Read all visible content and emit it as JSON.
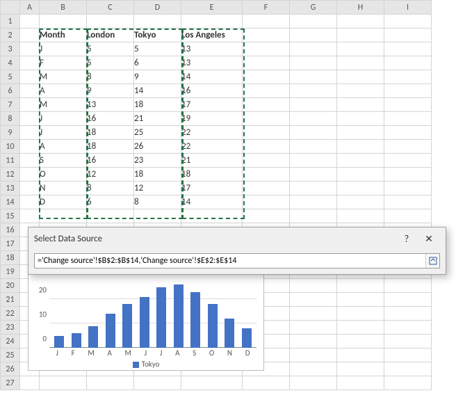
{
  "columns": [
    "A",
    "B",
    "C",
    "D",
    "E",
    "F",
    "G",
    "H",
    "I"
  ],
  "rowCount": 27,
  "table": {
    "headers": {
      "month": "Month",
      "london": "London",
      "tokyo": "Tokyo",
      "la": "Los Angeles"
    },
    "rows": [
      {
        "m": "J",
        "london": "5",
        "tokyo": "5",
        "la": "13"
      },
      {
        "m": "F",
        "london": "5",
        "tokyo": "6",
        "la": "13"
      },
      {
        "m": "M",
        "london": "8",
        "tokyo": "9",
        "la": "14"
      },
      {
        "m": "A",
        "london": "9",
        "tokyo": "14",
        "la": "16"
      },
      {
        "m": "M",
        "london": "13",
        "tokyo": "18",
        "la": "17"
      },
      {
        "m": "J",
        "london": "16",
        "tokyo": "21",
        "la": "19"
      },
      {
        "m": "J",
        "london": "18",
        "tokyo": "25",
        "la": "22"
      },
      {
        "m": "A",
        "london": "18",
        "tokyo": "26",
        "la": "22"
      },
      {
        "m": "S",
        "london": "16",
        "tokyo": "23",
        "la": "21"
      },
      {
        "m": "O",
        "london": "12",
        "tokyo": "18",
        "la": "18"
      },
      {
        "m": "N",
        "london": "8",
        "tokyo": "12",
        "la": "17"
      },
      {
        "m": "D",
        "london": "6",
        "tokyo": "8",
        "la": "14"
      }
    ]
  },
  "dialog": {
    "title": "Select Data Source",
    "help": "?",
    "close": "✕",
    "formula": "='Change source'!$B$2:$B$14,'Change source'!$E$2:$E$14"
  },
  "chart_data": {
    "type": "bar",
    "categories": [
      "J",
      "F",
      "M",
      "A",
      "M",
      "J",
      "J",
      "A",
      "S",
      "O",
      "N",
      "D"
    ],
    "values": [
      5,
      6,
      9,
      14,
      18,
      21,
      25,
      26,
      23,
      18,
      12,
      8
    ],
    "series_name": "Tokyo",
    "ylabel": "",
    "xlabel": "",
    "ylim": [
      0,
      30
    ],
    "yticks": [
      0,
      10,
      20
    ],
    "legend_position": "bottom"
  }
}
